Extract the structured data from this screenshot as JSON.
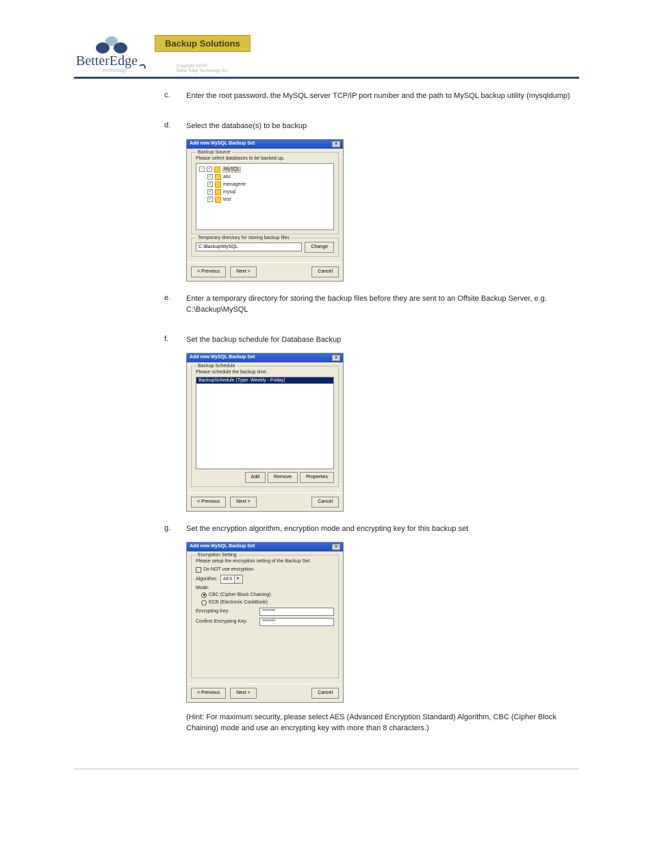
{
  "header": {
    "brand_top": "BetterEdge",
    "brand_sub": "technology",
    "banner": "Backup Solutions",
    "copyright1": "Copyright 2003©",
    "copyright2": "Better Edge Technology, Inc."
  },
  "items": {
    "c": {
      "letter": "c.",
      "text": "Enter the root password, the MySQL server TCP/IP port number and the path to MySQL backup utility (mysqldump)"
    },
    "d": {
      "letter": "d.",
      "text": "Select the database(s) to be backup"
    },
    "e": {
      "letter": "e.",
      "text": "Enter a temporary directory for storing the backup files before they are sent to an Offsite Backup Server, e.g. C:\\Backup\\MySQL"
    },
    "f": {
      "letter": "f.",
      "text": "Set the backup schedule for Database Backup"
    },
    "g": {
      "letter": "g.",
      "text": "Set the encryption algorithm, encryption mode and encrypting key for this backup set"
    }
  },
  "hint": "(Hint: For maximum security, please select AES (Advanced Encryption Standard) Algorithm, CBC (Cipher Block Chaining) mode and use an encrypting key with more than 8 characters.)",
  "dialog1": {
    "title": "Add new MySQL Backup Set",
    "group": "Backup Source",
    "instruction": "Please select databases to be backed up.",
    "tree": {
      "root": "MySQL",
      "children": [
        "abc",
        "menagerie",
        "mysql",
        "test"
      ]
    },
    "tempdir_label": "Temporary directory for storing backup files",
    "tempdir_value": "C:\\Backup\\MySQL",
    "change": "Change",
    "prev": "< Previous",
    "next": "Next >",
    "cancel": "Cancel"
  },
  "dialog2": {
    "title": "Add new MySQL Backup Set",
    "group": "Backup Schedule",
    "instruction": "Please schedule the backup time.",
    "list_item": "BackupSchedule (Type: Weekly - Friday)",
    "add": "Add",
    "remove": "Remove",
    "properties": "Properties",
    "prev": "< Previous",
    "next": "Next >",
    "cancel": "Cancel"
  },
  "dialog3": {
    "title": "Add new MySQL Backup Set",
    "group": "Encryption Setting",
    "instruction": "Please setup the encryption setting of the Backup Set.",
    "no_encrypt": "Do NOT use encryption.",
    "algo_label": "Algorithm:",
    "algo_value": "AES",
    "mode_label": "Mode:",
    "mode_cbc": "CBC (Cipher Block Chaining)",
    "mode_ecb": "ECB (Electronic CookBook)",
    "key_label": "Encrypting Key:",
    "key_value": "*******",
    "confirm_label": "Confirm Encrypting Key:",
    "confirm_value": "*******",
    "prev": "< Previous",
    "next": "Next >",
    "cancel": "Cancel"
  }
}
